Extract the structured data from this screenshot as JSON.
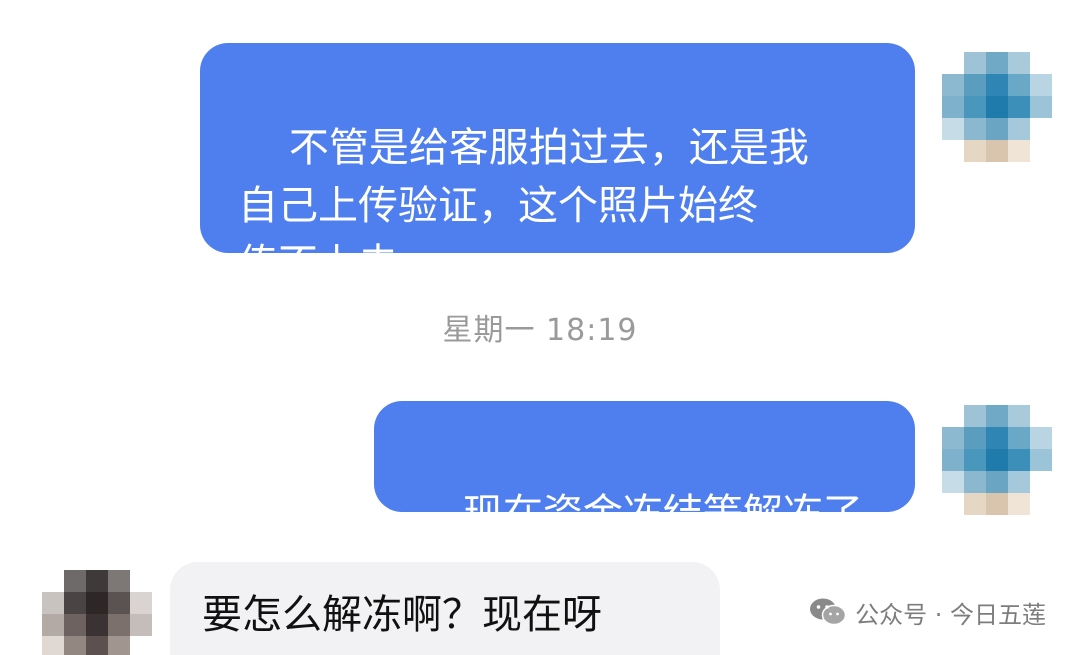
{
  "messages": [
    {
      "side": "outgoing",
      "text": "不管是给客服拍过去，还是我\n自己上传验证，这个照片始终\n传不上去"
    },
    {
      "side": "outgoing",
      "text": "现在资金冻结等解冻了"
    },
    {
      "side": "incoming",
      "text": "要怎么解冻啊？现在呀"
    }
  ],
  "timestamp": "星期一 18:19",
  "watermark": {
    "text": "公众号 · 今日五莲",
    "icon": "wechat-icon"
  },
  "colors": {
    "outgoing_bubble": "#4f7fef",
    "incoming_bubble": "#f2f2f4",
    "timestamp_text": "#9a9a9a"
  }
}
